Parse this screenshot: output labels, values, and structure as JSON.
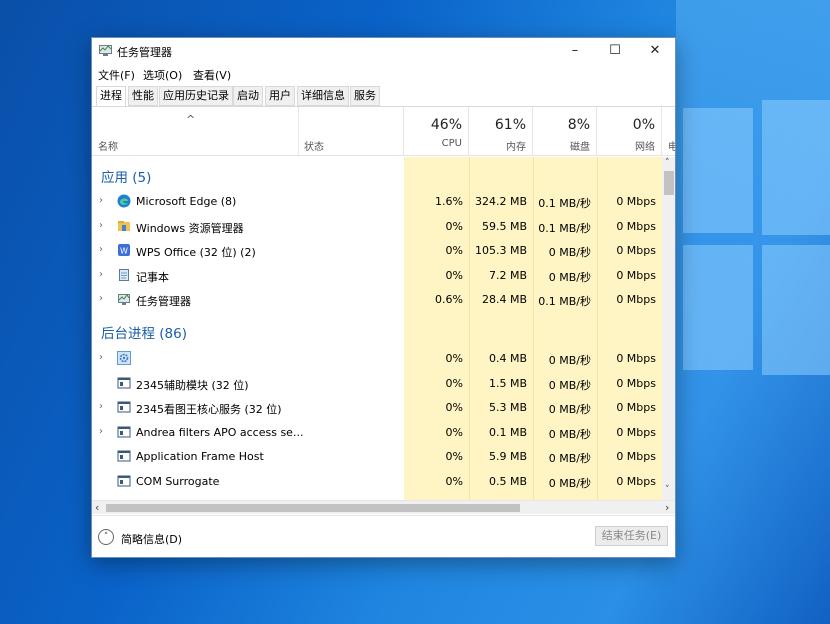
{
  "window": {
    "title": "任务管理器",
    "minimize": "–",
    "maximize": "☐",
    "close": "✕"
  },
  "menu": [
    "文件(F)",
    "选项(O)",
    "查看(V)"
  ],
  "tabs": [
    "进程",
    "性能",
    "应用历史记录",
    "启动",
    "用户",
    "详细信息",
    "服务"
  ],
  "header": {
    "sort_indicator": "^",
    "name": "名称",
    "status": "状态",
    "cpu": {
      "pct": "46%",
      "label": "CPU"
    },
    "mem": {
      "pct": "61%",
      "label": "内存"
    },
    "disk": {
      "pct": "8%",
      "label": "磁盘"
    },
    "net": {
      "pct": "0%",
      "label": "网络"
    },
    "extra": "电"
  },
  "groups": {
    "apps": "应用 (5)",
    "background": "后台进程 (86)"
  },
  "apps": [
    {
      "name": "Microsoft Edge (8)",
      "cpu": "1.6%",
      "mem": "324.2 MB",
      "disk": "0.1 MB/秒",
      "net": "0 Mbps",
      "icon": "edge-icon"
    },
    {
      "name": "Windows 资源管理器",
      "cpu": "0%",
      "mem": "59.5 MB",
      "disk": "0.1 MB/秒",
      "net": "0 Mbps",
      "icon": "explorer-icon"
    },
    {
      "name": "WPS Office (32 位) (2)",
      "cpu": "0%",
      "mem": "105.3 MB",
      "disk": "0 MB/秒",
      "net": "0 Mbps",
      "icon": "wps-icon"
    },
    {
      "name": "记事本",
      "cpu": "0%",
      "mem": "7.2 MB",
      "disk": "0 MB/秒",
      "net": "0 Mbps",
      "icon": "notepad-icon"
    },
    {
      "name": "任务管理器",
      "cpu": "0.6%",
      "mem": "28.4 MB",
      "disk": "0.1 MB/秒",
      "net": "0 Mbps",
      "icon": "taskmgr-icon"
    }
  ],
  "background": [
    {
      "name": "",
      "cpu": "0%",
      "mem": "0.4 MB",
      "disk": "0 MB/秒",
      "net": "0 Mbps",
      "icon": "gear-icon"
    },
    {
      "name": "2345辅助模块 (32 位)",
      "cpu": "0%",
      "mem": "1.5 MB",
      "disk": "0 MB/秒",
      "net": "0 Mbps",
      "icon": "app-window-icon"
    },
    {
      "name": "2345看图王核心服务 (32 位)",
      "cpu": "0%",
      "mem": "5.3 MB",
      "disk": "0 MB/秒",
      "net": "0 Mbps",
      "icon": "app-window-icon"
    },
    {
      "name": "Andrea filters APO access se...",
      "cpu": "0%",
      "mem": "0.1 MB",
      "disk": "0 MB/秒",
      "net": "0 Mbps",
      "icon": "app-window-icon"
    },
    {
      "name": "Application Frame Host",
      "cpu": "0%",
      "mem": "5.9 MB",
      "disk": "0 MB/秒",
      "net": "0 Mbps",
      "icon": "app-window-icon"
    },
    {
      "name": "COM Surrogate",
      "cpu": "0%",
      "mem": "0.5 MB",
      "disk": "0 MB/秒",
      "net": "0 Mbps",
      "icon": "app-window-icon"
    }
  ],
  "footer": {
    "fewer_details": "简略信息(D)",
    "end_task": "结束任务(E)"
  }
}
